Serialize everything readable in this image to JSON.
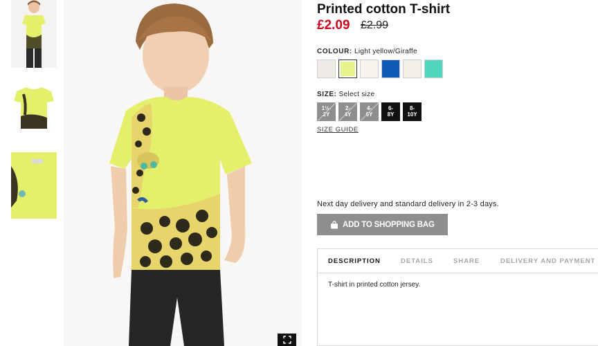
{
  "product": {
    "title": "Printed cotton T-shirt",
    "price": "£2.09",
    "old_price": "£2.99"
  },
  "colour": {
    "label": "COLOUR:",
    "selected": "Light yellow/Giraffe",
    "swatches": [
      {
        "name": "light grey",
        "hex": "#eeebe6"
      },
      {
        "name": "light yellow",
        "hex": "#e6f28c"
      },
      {
        "name": "off white",
        "hex": "#f6f3ec"
      },
      {
        "name": "blue",
        "hex": "#0e5bb5"
      },
      {
        "name": "natural white",
        "hex": "#f3f0ea"
      },
      {
        "name": "turquoise",
        "hex": "#4ed6be"
      }
    ]
  },
  "size": {
    "label": "SIZE:",
    "prompt": "Select size",
    "options": [
      {
        "top": "1½-",
        "bottom": "2Y",
        "available": false
      },
      {
        "top": "2-",
        "bottom": "4Y",
        "available": false
      },
      {
        "top": "4-",
        "bottom": "6Y",
        "available": false
      },
      {
        "top": "6-",
        "bottom": "8Y",
        "available": true
      },
      {
        "top": "8-",
        "bottom": "10Y",
        "available": true
      }
    ],
    "guide": "SIZE GUIDE"
  },
  "delivery_text": "Next day delivery and standard delivery in 2-3 days.",
  "add_button": "ADD TO SHOPPING BAG",
  "tabs": [
    {
      "label": "DESCRIPTION",
      "active": true
    },
    {
      "label": "DETAILS",
      "active": false
    },
    {
      "label": "SHARE",
      "active": false
    },
    {
      "label": "DELIVERY AND PAYMENT",
      "active": false
    }
  ],
  "description": "T-shirt in printed cotton jersey.",
  "icons": {
    "zoom": "fullscreen-icon",
    "bag": "shopping-bag-icon"
  },
  "colors": {
    "price_red": "#d0021b",
    "button_grey": "#8e8e8e"
  }
}
